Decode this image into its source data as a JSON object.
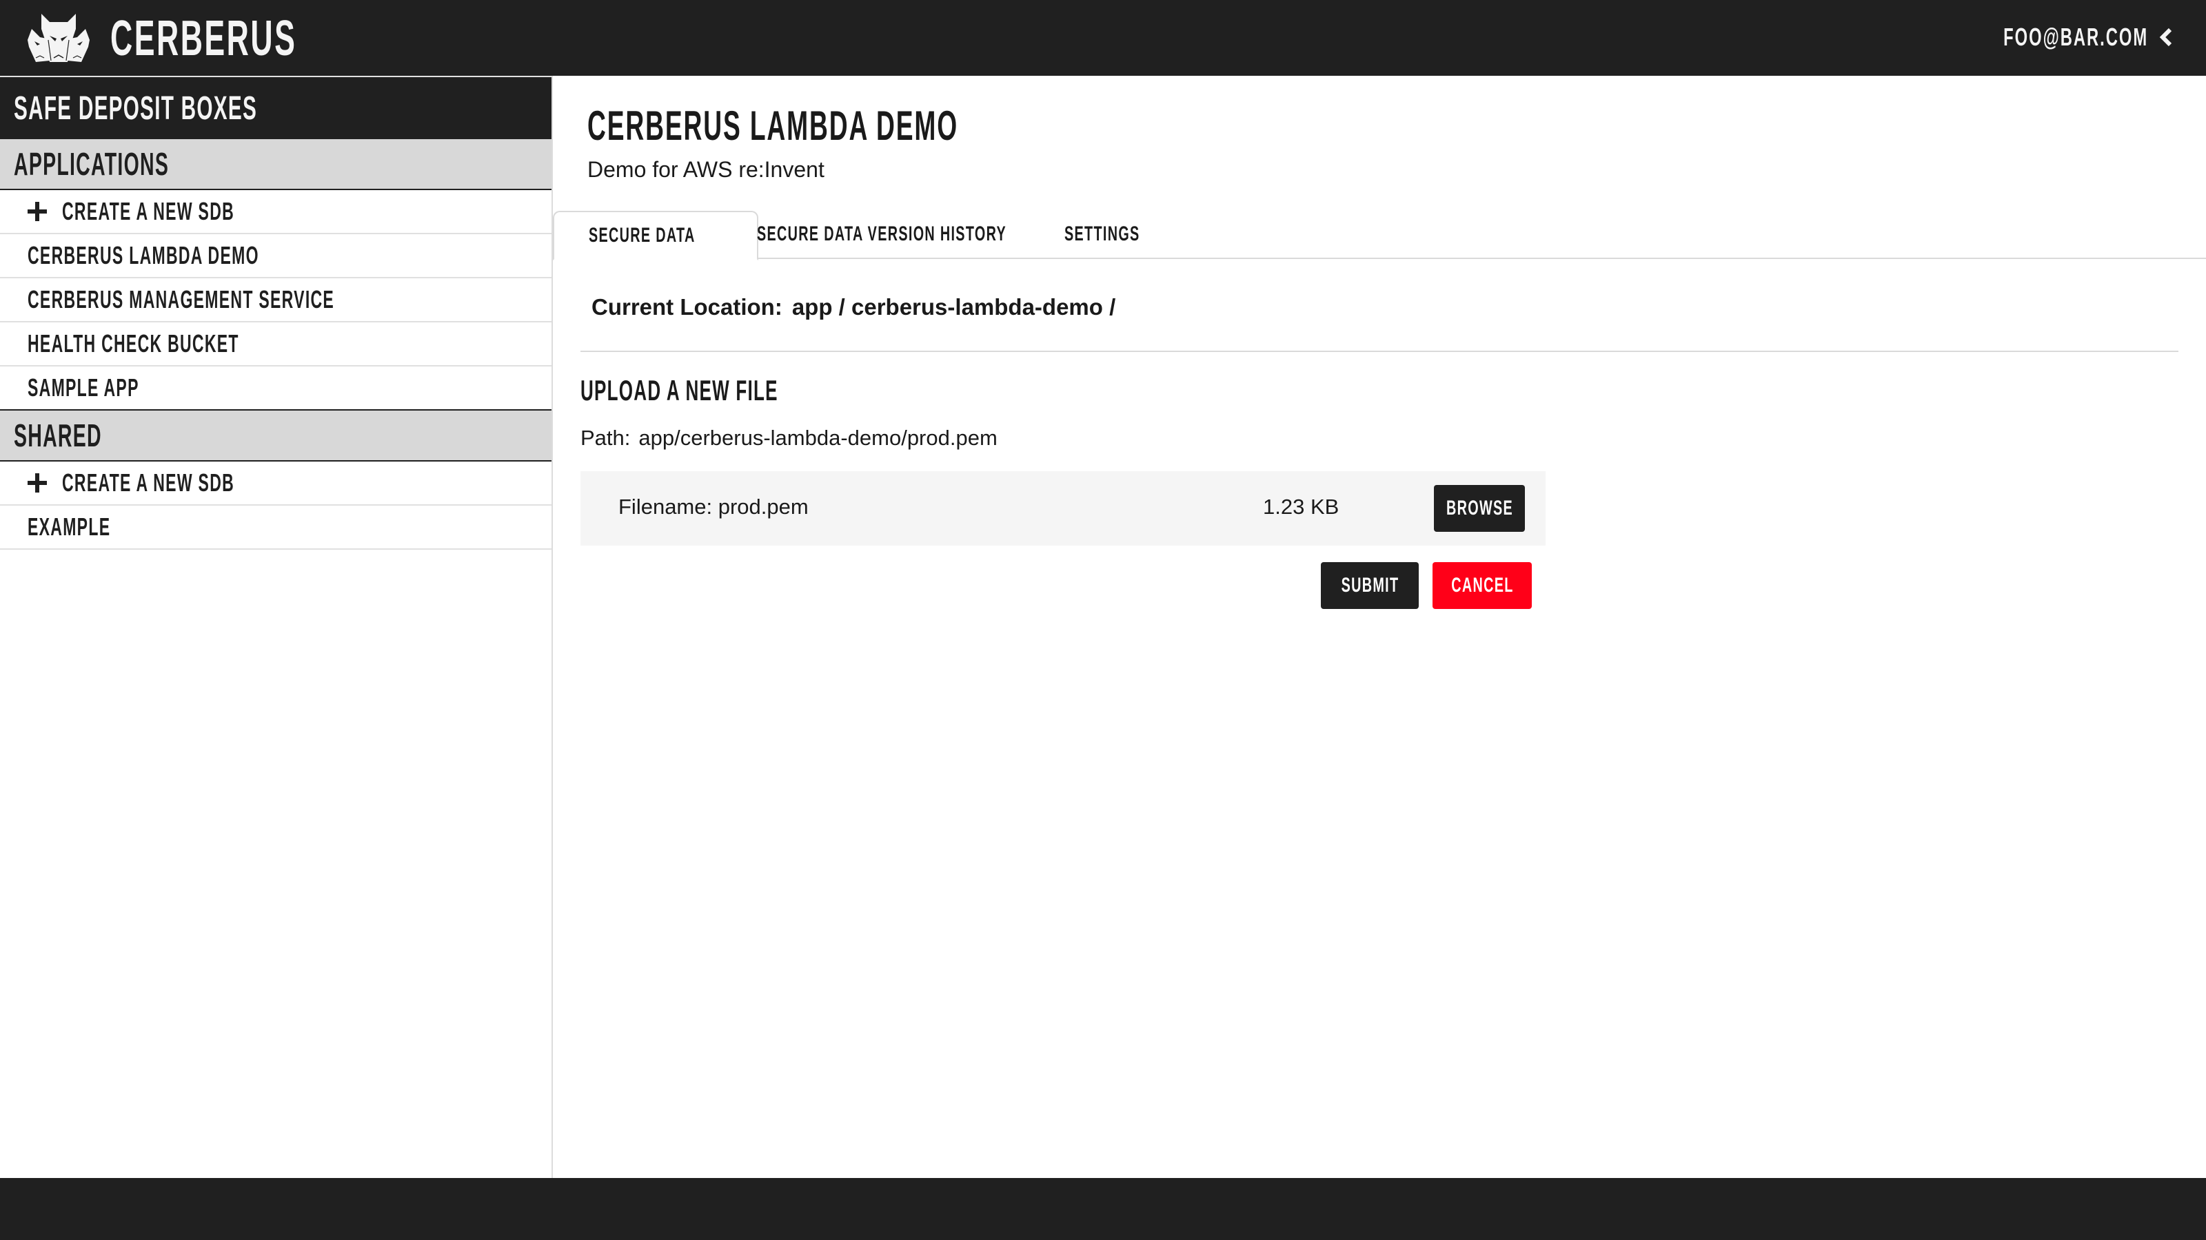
{
  "header": {
    "brand": "CERBERUS",
    "logo_icon": "three-headed-dog-logo",
    "user_email": "FOO@BAR.COM",
    "user_menu_icon": "chevron-left-icon"
  },
  "sidebar": {
    "title": "SAFE DEPOSIT BOXES",
    "categories": [
      {
        "label": "APPLICATIONS",
        "create_label": "CREATE A NEW SDB",
        "items": [
          "CERBERUS LAMBDA DEMO",
          "CERBERUS MANAGEMENT SERVICE",
          "HEALTH CHECK BUCKET",
          "SAMPLE APP"
        ]
      },
      {
        "label": "SHARED",
        "create_label": "CREATE A NEW SDB",
        "items": [
          "EXAMPLE"
        ]
      }
    ]
  },
  "main": {
    "sdb_name": "CERBERUS LAMBDA DEMO",
    "sdb_description": "Demo for AWS re:Invent",
    "tabs": [
      {
        "label": "SECURE DATA",
        "active": true
      },
      {
        "label": "SECURE DATA VERSION HISTORY",
        "active": false
      },
      {
        "label": "SETTINGS",
        "active": false
      }
    ],
    "current_location_label": "Current Location:",
    "current_location_value": "app / cerberus-lambda-demo /",
    "upload": {
      "title": "UPLOAD A NEW FILE",
      "path_label": "Path:",
      "path_value": "app/cerberus-lambda-demo/prod.pem",
      "filename_text": "Filename: prod.pem",
      "filesize": "1.23 KB",
      "browse_label": "BROWSE",
      "submit_label": "SUBMIT",
      "cancel_label": "CANCEL"
    }
  },
  "colors": {
    "dark": "#202020",
    "cancel_red": "#ff0018",
    "category_bg": "#d8d8d8",
    "file_box_bg": "#f5f5f5"
  }
}
